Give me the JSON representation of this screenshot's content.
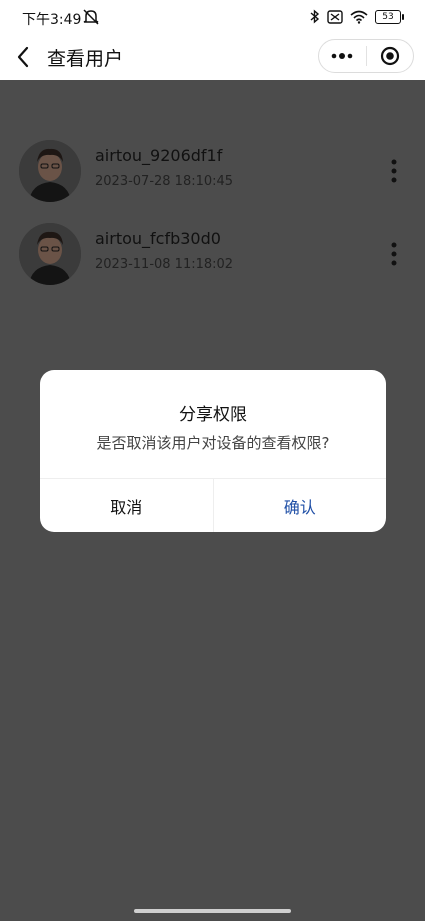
{
  "status_bar": {
    "time": "下午3:49",
    "battery": "53",
    "icons": [
      "bell-off-icon",
      "bluetooth-icon",
      "sim-off-icon",
      "wifi-icon",
      "battery-icon"
    ]
  },
  "nav": {
    "title": "查看用户",
    "back_icon": "chevron-left-icon",
    "more_icon": "more-dots-icon",
    "close_icon": "target-icon"
  },
  "users": [
    {
      "name": "airtou_9206df1f",
      "date": "2023-07-28 18:10:45"
    },
    {
      "name": "airtou_fcfb30d0",
      "date": "2023-11-08 11:18:02"
    }
  ],
  "dialog": {
    "title": "分享权限",
    "message": "是否取消该用户对设备的查看权限?",
    "cancel_label": "取消",
    "confirm_label": "确认"
  },
  "colors": {
    "overlay": "#4c4c4c",
    "confirm": "#1f4fa6"
  }
}
